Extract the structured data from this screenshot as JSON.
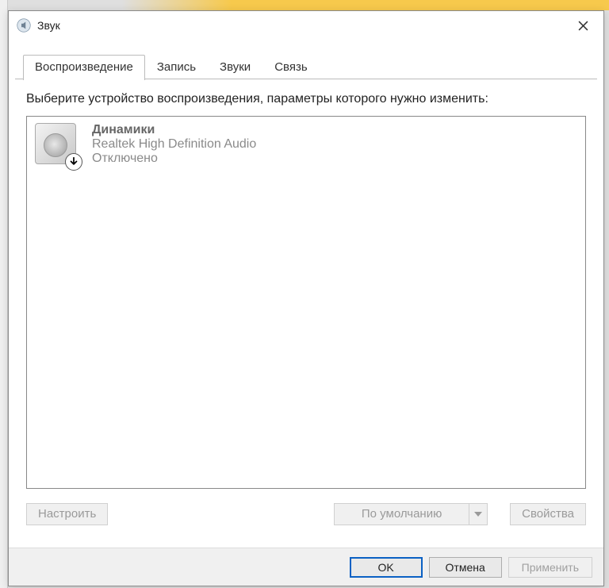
{
  "titlebar": {
    "title": "Звук"
  },
  "tabs": [
    {
      "label": "Воспроизведение",
      "active": true
    },
    {
      "label": "Запись",
      "active": false
    },
    {
      "label": "Звуки",
      "active": false
    },
    {
      "label": "Связь",
      "active": false
    }
  ],
  "instructions": "Выберите устройство воспроизведения, параметры которого нужно изменить:",
  "devices": [
    {
      "name": "Динамики",
      "driver": "Realtek High Definition Audio",
      "status": "Отключено",
      "icon": "speaker",
      "overlay": "disabled-down-arrow"
    }
  ],
  "tab_buttons": {
    "configure": "Настроить",
    "set_default": "По умолчанию",
    "properties": "Свойства"
  },
  "footer": {
    "ok": "OK",
    "cancel": "Отмена",
    "apply": "Применить"
  }
}
